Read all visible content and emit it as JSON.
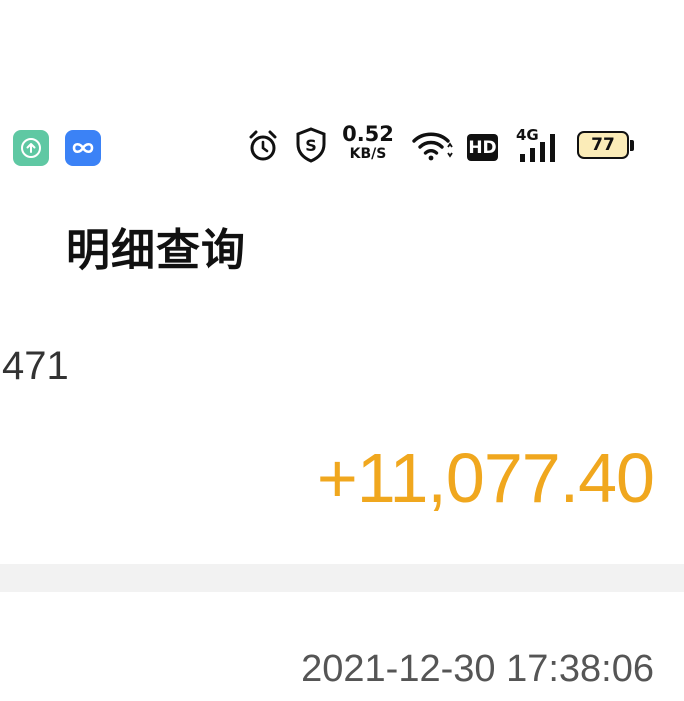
{
  "status_bar": {
    "left_icons": [
      "upload-circle-icon",
      "infinity-loop-icon"
    ],
    "right_icons": [
      "alarm-clock-icon",
      "shield-s-icon",
      "wifi-icon",
      "hd-icon",
      "signal-4g-icon",
      "battery-icon"
    ],
    "network_speed_value": "0.52",
    "network_speed_unit": "KB/S",
    "hd_label": "HD",
    "network_type": "4G",
    "battery_level": "77",
    "colors": {
      "upload_app": "#5fc8a3",
      "loop_app": "#3b82f6",
      "battery_fill": "#fbecb8"
    }
  },
  "header": {
    "title": "明细查询"
  },
  "transaction": {
    "account_suffix": "471",
    "amount": "+11,077.40",
    "amount_color": "#f0a71e",
    "timestamp": "2021-12-30 17:38:06"
  }
}
